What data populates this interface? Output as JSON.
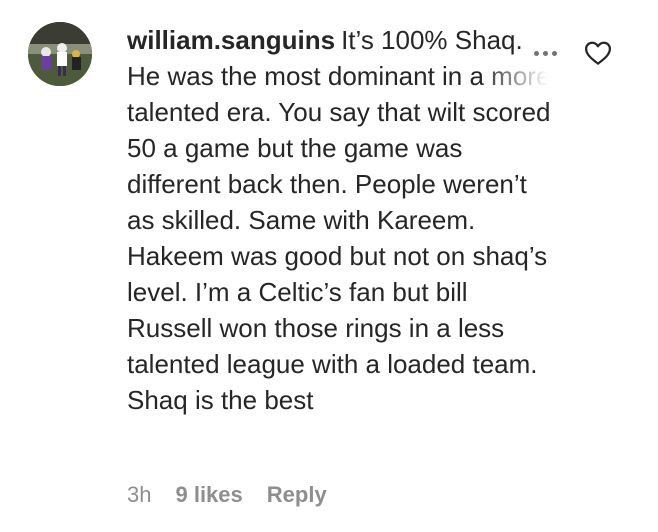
{
  "comment": {
    "username": "william.sanguins",
    "text": "It’s 100% Shaq. He was the most dominant in a more talented era. You say that wilt scored 50 a game but the game was different back then. People weren’t as skilled. Same with Kareem. Hakeem was good but not on shaq’s level. I’m a Celtic’s fan but bill Russell won those rings in a less talented league with a loaded team. Shaq is the best",
    "time": "3h",
    "likes": "9 likes",
    "reply_label": "Reply"
  },
  "icons": {
    "more": "more-options-icon",
    "like": "heart-outline-icon"
  },
  "colors": {
    "text": "#262626",
    "meta": "#8e8e8e",
    "icon": "#262626"
  }
}
